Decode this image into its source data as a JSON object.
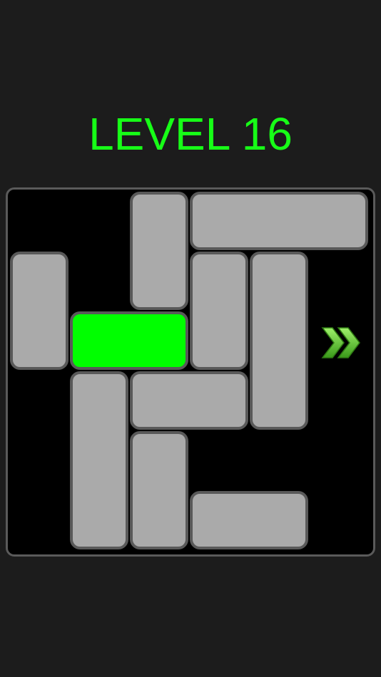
{
  "header": {
    "level_label": "LEVEL 16"
  },
  "board": {
    "grid_size": 6,
    "blocks": [
      {
        "id": "v1",
        "col": 2,
        "row": 0,
        "w": 1,
        "h": 2,
        "target": false
      },
      {
        "id": "h1",
        "col": 3,
        "row": 0,
        "w": 3,
        "h": 1,
        "target": false
      },
      {
        "id": "v2",
        "col": 0,
        "row": 1,
        "w": 1,
        "h": 2,
        "target": false
      },
      {
        "id": "v3",
        "col": 3,
        "row": 1,
        "w": 1,
        "h": 2,
        "target": false
      },
      {
        "id": "v4",
        "col": 4,
        "row": 1,
        "w": 1,
        "h": 3,
        "target": false
      },
      {
        "id": "main",
        "col": 1,
        "row": 2,
        "w": 2,
        "h": 1,
        "target": true
      },
      {
        "id": "v5",
        "col": 1,
        "row": 3,
        "w": 1,
        "h": 3,
        "target": false
      },
      {
        "id": "h2",
        "col": 2,
        "row": 3,
        "w": 2,
        "h": 1,
        "target": false
      },
      {
        "id": "v6",
        "col": 2,
        "row": 4,
        "w": 1,
        "h": 2,
        "target": false
      },
      {
        "id": "h3",
        "col": 3,
        "row": 5,
        "w": 2,
        "h": 1,
        "target": false
      }
    ]
  },
  "exit": {
    "icon": "double-chevron-right-icon",
    "color": "#6fd13a"
  },
  "colors": {
    "title": "#17ff17",
    "target_block": "#00ff00",
    "block": "#aaaaaa",
    "block_border": "#595959",
    "board_bg": "#000000"
  }
}
